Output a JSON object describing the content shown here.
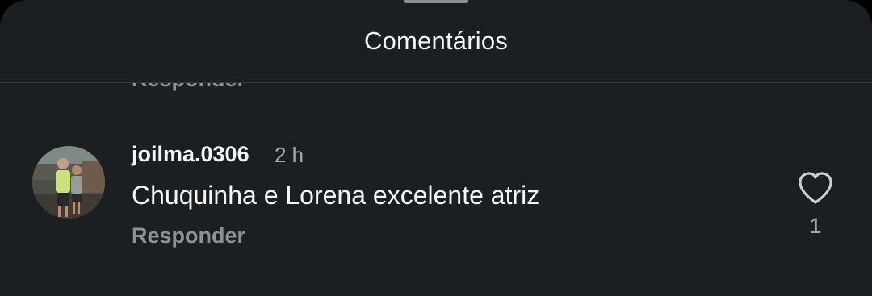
{
  "sheet": {
    "title": "Comentários"
  },
  "previous_comment": {
    "reply_label": "Responder"
  },
  "comment": {
    "username": "joilma.0306",
    "timestamp": "2 h",
    "text": "Chuquinha e Lorena excelente atriz",
    "reply_label": "Responder",
    "like_count": "1",
    "like_icon": "heart-outline-icon"
  },
  "colors": {
    "background": "#1c1f22",
    "primary_text": "#f5f5f5",
    "secondary_text": "#8d9196"
  }
}
